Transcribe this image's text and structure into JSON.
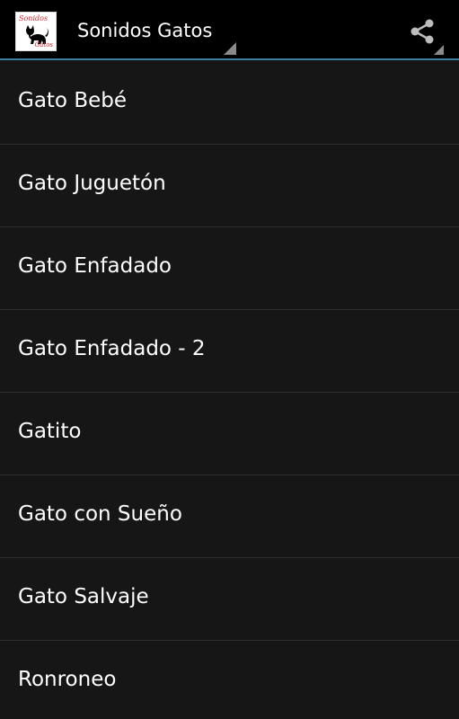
{
  "action_bar": {
    "logo": {
      "text_top": "Sonidos",
      "text_bottom": "Gatos",
      "icon": "black-cat-icon"
    },
    "title": "Sonidos Gatos",
    "share_icon": "share-icon",
    "accent_color": "#3c7ea1"
  },
  "sounds": {
    "items": [
      {
        "label": "Gato Bebé"
      },
      {
        "label": "Gato Juguetón"
      },
      {
        "label": "Gato Enfadado"
      },
      {
        "label": "Gato Enfadado - 2"
      },
      {
        "label": "Gatito"
      },
      {
        "label": "Gato con Sueño"
      },
      {
        "label": "Gato Salvaje"
      },
      {
        "label": "Ronroneo"
      }
    ]
  }
}
